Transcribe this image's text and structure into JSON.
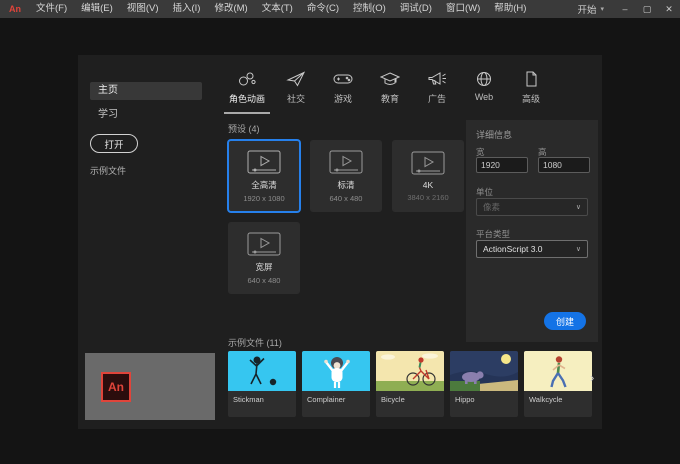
{
  "brand": {
    "logo_text": "An"
  },
  "titlebar": {
    "menus": [
      "文件(F)",
      "编辑(E)",
      "视图(V)",
      "插入(I)",
      "修改(M)",
      "文本(T)",
      "命令(C)",
      "控制(O)",
      "调试(D)",
      "窗口(W)",
      "帮助(H)"
    ],
    "workspace": "开始",
    "workspace_caret": "▾",
    "window_controls": {
      "minimize": "–",
      "maximize": "▢",
      "close": "✕"
    }
  },
  "sidebar": {
    "items": [
      {
        "label": "主页",
        "selected": true
      },
      {
        "label": "学习",
        "selected": false
      }
    ],
    "open_button": "打开",
    "footer_link": "示例文件"
  },
  "tabs": [
    {
      "label": "角色动画",
      "icon": "character-icon",
      "selected": true
    },
    {
      "label": "社交",
      "icon": "paper-plane-icon",
      "selected": false
    },
    {
      "label": "游戏",
      "icon": "gamepad-icon",
      "selected": false
    },
    {
      "label": "教育",
      "icon": "graduation-cap-icon",
      "selected": false
    },
    {
      "label": "广告",
      "icon": "megaphone-icon",
      "selected": false
    },
    {
      "label": "Web",
      "icon": "globe-icon",
      "selected": false
    },
    {
      "label": "高级",
      "icon": "document-icon",
      "selected": false
    }
  ],
  "presets": {
    "header": "预设 (4)",
    "cards": [
      {
        "label": "全高清",
        "dims": "1920 x 1080",
        "selected": true
      },
      {
        "label": "标清",
        "dims": "640 x 480",
        "selected": false
      },
      {
        "label": "4K",
        "dims": "3840 x 2160",
        "selected": false
      },
      {
        "label": "宽屏",
        "dims": "640 x 480",
        "selected": false
      }
    ]
  },
  "details": {
    "header": "详细信息",
    "width_label": "宽",
    "width_value": "1920",
    "height_label": "高",
    "height_value": "1080",
    "unit_label": "单位",
    "unit_value": "像素",
    "platform_label": "平台类型",
    "platform_value": "ActionScript 3.0",
    "select_caret": "∨",
    "create_button": "创建"
  },
  "samples": {
    "header": "示例文件 (11)",
    "cards": [
      {
        "name": "Stickman"
      },
      {
        "name": "Complainer"
      },
      {
        "name": "Bicycle"
      },
      {
        "name": "Hippo"
      },
      {
        "name": "Walkcycle"
      }
    ],
    "more_arrow": "›"
  },
  "colors": {
    "titlebar": "#3a3a3a",
    "window-bg": "#141414",
    "panel": "#1f1f1f",
    "card": "#2d2d2d",
    "details": "#2a2a2a",
    "accent": "#1473e6",
    "select-border": "#2680eb",
    "logo-red": "#e0443a",
    "thumb-cyan": "#36c6f0",
    "thumb-cream": "#f4e6ae",
    "thumb-night": "#2c3d63"
  }
}
